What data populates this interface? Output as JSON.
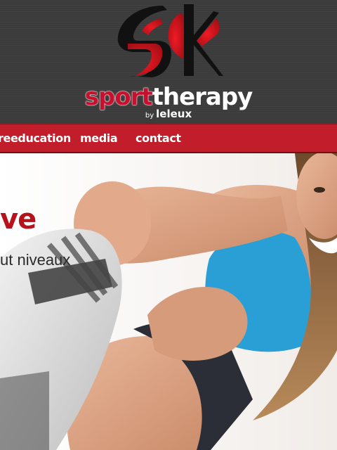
{
  "brand": {
    "wordmark_part1": "sport",
    "wordmark_part2": "therapy",
    "by": "by",
    "byline": "leleux",
    "colors": {
      "accent": "#c8102e",
      "header_bg": "#3b3b3b",
      "nav_bg": "#c11d2a"
    }
  },
  "nav": {
    "items": [
      {
        "label": "reeducation"
      },
      {
        "label": "media"
      },
      {
        "label": "contact"
      }
    ]
  },
  "hero": {
    "title": "ve",
    "subtitle": "ut niveaux"
  }
}
